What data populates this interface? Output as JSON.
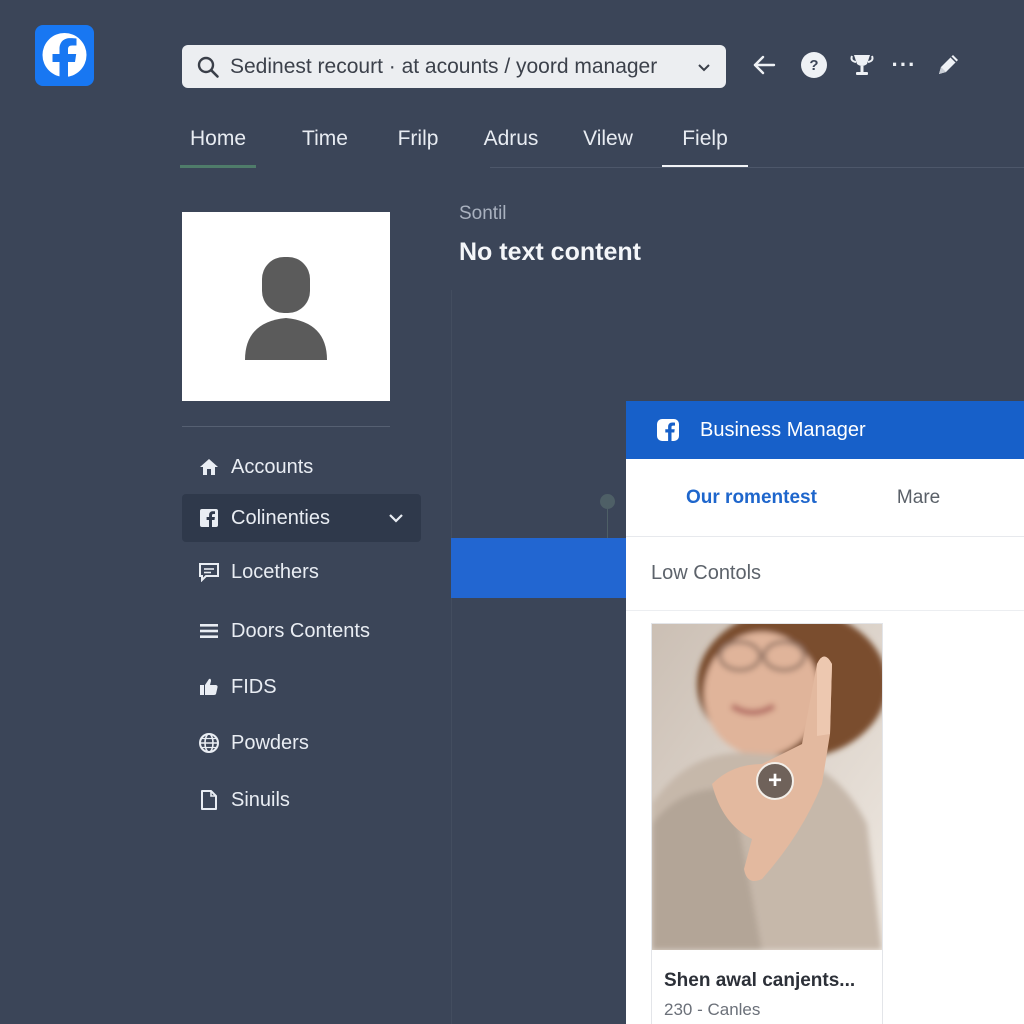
{
  "app": {
    "brand_color": "#1877f2",
    "logo_icon": "facebook-logo-icon"
  },
  "search": {
    "value": "Sedinest recourt · at acounts / yoord manager",
    "icon": "search-icon"
  },
  "toolbar": {
    "icons": [
      "back-arrow-icon",
      "help-icon",
      "trophy-icon",
      "more-icon",
      "edit-icon"
    ],
    "help_glyph": "?",
    "more_glyph": "···"
  },
  "nav": {
    "tabs": [
      "Home",
      "Time",
      "Frilp",
      "Adrus",
      "Vilew",
      "Fielp"
    ]
  },
  "sidebar": {
    "items": [
      {
        "label": "Accounts",
        "icon": "home-icon"
      },
      {
        "label": "Colinenties",
        "icon": "facebook-square-icon"
      },
      {
        "label": "Locethers",
        "icon": "chat-icon"
      },
      {
        "label": "Doors Contents",
        "icon": "list-icon"
      },
      {
        "label": "FIDS",
        "icon": "thumbs-up-icon"
      },
      {
        "label": "Powders",
        "icon": "globe-icon"
      },
      {
        "label": "Sinuils",
        "icon": "document-icon"
      }
    ],
    "active_index": 1
  },
  "main": {
    "subtitle": "Sontil",
    "title": "No text content",
    "accent_color": "#2266d1"
  },
  "panel": {
    "header": "Business Manager",
    "header_color": "#1760c9",
    "tabs": [
      "Our romentest",
      "Mare"
    ],
    "section": "Low Contols",
    "card": {
      "title": "Shen awal canjents...",
      "subtitle": "230 - Canles",
      "plus_glyph": "+"
    }
  }
}
